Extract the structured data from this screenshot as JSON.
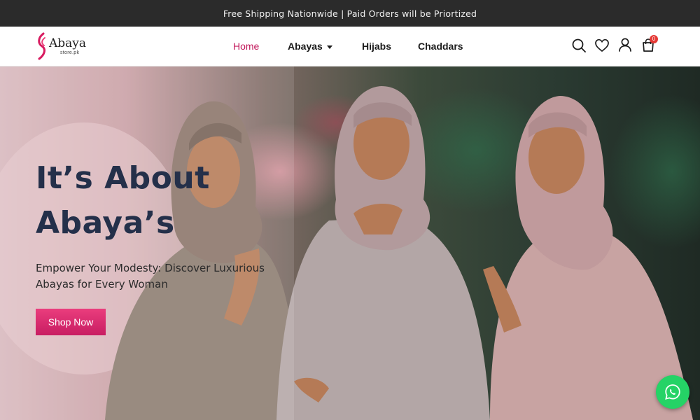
{
  "announcement": {
    "text": "Free Shipping Nationwide | Paid Orders will be Priortized"
  },
  "brand": {
    "name": "Abaya",
    "sub": "store.pk",
    "accent": "#c2185b"
  },
  "nav": {
    "items": [
      {
        "label": "Home",
        "active": true
      },
      {
        "label": "Abayas",
        "has_dropdown": true
      },
      {
        "label": "Hijabs"
      },
      {
        "label": "Chaddars"
      }
    ]
  },
  "header_icons": [
    "search-icon",
    "heart-icon",
    "user-icon",
    "cart-icon"
  ],
  "cart": {
    "count": "0"
  },
  "hero": {
    "title_line1": "It’s About",
    "title_line2": "Abaya’s",
    "subtitle": "Empower Your Modesty: Discover Luxurious Abayas for Every Woman",
    "cta_label": "Shop Now",
    "cta_color": "#e0306f",
    "title_color": "#24304a"
  },
  "floating": {
    "icon": "whatsapp-icon",
    "color": "#25d366"
  }
}
